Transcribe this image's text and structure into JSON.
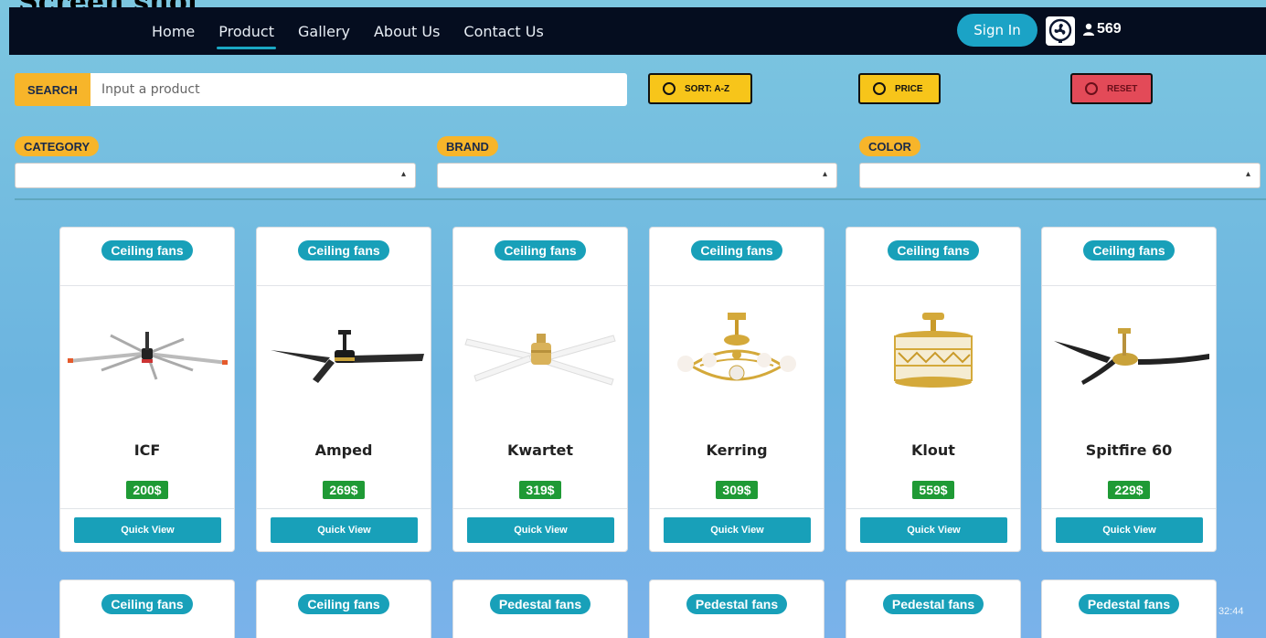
{
  "caption": "Screen shot",
  "nav": {
    "links": [
      "Home",
      "Product",
      "Gallery",
      "About Us",
      "Contact Us"
    ],
    "active_index": 1,
    "signin": "Sign In",
    "user_count": "569"
  },
  "search": {
    "label": "SEARCH",
    "placeholder": "Input a product"
  },
  "buttons": {
    "sort": "SORT: A-Z",
    "price": "PRICE",
    "reset": "RESET"
  },
  "filters": {
    "category": "CATEGORY",
    "brand": "BRAND",
    "color": "COLOR"
  },
  "products": [
    {
      "category": "Ceiling fans",
      "name": "ICF",
      "price": "200$",
      "action": "Quick View"
    },
    {
      "category": "Ceiling fans",
      "name": "Amped",
      "price": "269$",
      "action": "Quick View"
    },
    {
      "category": "Ceiling fans",
      "name": "Kwartet",
      "price": "319$",
      "action": "Quick View"
    },
    {
      "category": "Ceiling fans",
      "name": "Kerring",
      "price": "309$",
      "action": "Quick View"
    },
    {
      "category": "Ceiling fans",
      "name": "Klout",
      "price": "559$",
      "action": "Quick View"
    },
    {
      "category": "Ceiling fans",
      "name": "Spitfire 60",
      "price": "229$",
      "action": "Quick View"
    }
  ],
  "next_row": [
    "Ceiling fans",
    "Ceiling fans",
    "Pedestal fans",
    "Pedestal fans",
    "Pedestal fans",
    "Pedestal fans"
  ],
  "time_fragment": "32:44",
  "colors": {
    "navbar": "#050d1f",
    "accent": "#18a0b9",
    "yellow": "#f7b52a",
    "price_green": "#1f9a35",
    "reset_red": "#e34a58"
  }
}
